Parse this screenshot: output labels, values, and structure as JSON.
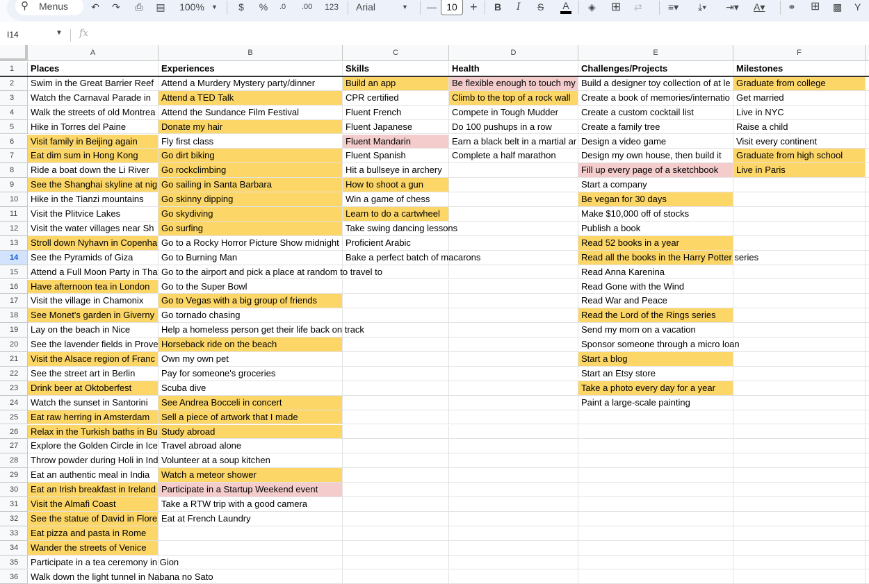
{
  "toolbar": {
    "menus_label": "Menus",
    "zoom": "100%",
    "currency": "$",
    "percent": "%",
    "decrease_decimals": ".0",
    "increase_decimals": ".00",
    "number_format": "123",
    "font": "Arial",
    "font_size": "10",
    "bold": "B",
    "italic": "I",
    "text_color": "A"
  },
  "formula_bar": {
    "cell_ref": "I14",
    "fx": "fx",
    "value": ""
  },
  "columns": [
    "A",
    "B",
    "C",
    "D",
    "E",
    "F"
  ],
  "selected_row": 14,
  "colors": {
    "yellow": "#fcd667",
    "pink": "#f4cccc",
    "selected_header": "#d3e3fd"
  },
  "rows": [
    {
      "n": "1",
      "bold": true,
      "cells": [
        {
          "t": "Places"
        },
        {
          "t": "Experiences"
        },
        {
          "t": "Skills"
        },
        {
          "t": "Health"
        },
        {
          "t": "Challenges/Projects"
        },
        {
          "t": "Milestones"
        }
      ]
    },
    {
      "n": "2",
      "cells": [
        {
          "t": "Swim in the Great Barrier Reef"
        },
        {
          "t": "Attend a Murdery Mystery party/dinner"
        },
        {
          "t": "Build an app",
          "f": "yellow"
        },
        {
          "t": "Be flexible enough to touch my",
          "f": "pink"
        },
        {
          "t": "Build a designer toy collection of at le"
        },
        {
          "t": "Graduate from college",
          "f": "yellow"
        }
      ]
    },
    {
      "n": "3",
      "cells": [
        {
          "t": "Watch the Carnaval Parade in"
        },
        {
          "t": "Attend a TED Talk",
          "f": "yellow"
        },
        {
          "t": "CPR certified"
        },
        {
          "t": "Climb to the top of a rock wall",
          "f": "yellow"
        },
        {
          "t": "Create a book of memories/internatio"
        },
        {
          "t": "Get married"
        }
      ]
    },
    {
      "n": "4",
      "cells": [
        {
          "t": "Walk the streets of old Montrea"
        },
        {
          "t": "Attend the Sundance Film Festival"
        },
        {
          "t": "Fluent French"
        },
        {
          "t": "Compete in Tough Mudder"
        },
        {
          "t": "Create a custom cocktail list"
        },
        {
          "t": "Live in NYC"
        }
      ]
    },
    {
      "n": "5",
      "cells": [
        {
          "t": "Hike in Torres del Paine"
        },
        {
          "t": "Donate my hair",
          "f": "yellow"
        },
        {
          "t": "Fluent Japanese"
        },
        {
          "t": "Do 100 pushups in a row"
        },
        {
          "t": "Create a family tree"
        },
        {
          "t": "Raise a child"
        }
      ]
    },
    {
      "n": "6",
      "cells": [
        {
          "t": "Visit family in Beijing again",
          "f": "yellow"
        },
        {
          "t": "Fly first class"
        },
        {
          "t": "Fluent Mandarin",
          "f": "pink"
        },
        {
          "t": "Earn a black belt in a martial ar"
        },
        {
          "t": "Design a video game"
        },
        {
          "t": "Visit every continent"
        }
      ]
    },
    {
      "n": "7",
      "cells": [
        {
          "t": "Eat dim sum in Hong Kong",
          "f": "yellow"
        },
        {
          "t": "Go dirt biking",
          "f": "yellow"
        },
        {
          "t": "Fluent Spanish"
        },
        {
          "t": "Complete a half marathon"
        },
        {
          "t": "Design my own house, then build it"
        },
        {
          "t": "Graduate from high school",
          "f": "yellow"
        }
      ]
    },
    {
      "n": "8",
      "cells": [
        {
          "t": "Ride a boat down the Li River"
        },
        {
          "t": "Go rockclimbing",
          "f": "yellow"
        },
        {
          "t": "Hit a bullseye in archery"
        },
        {
          "t": ""
        },
        {
          "t": "Fill up every page of a sketchbook",
          "f": "pink"
        },
        {
          "t": "Live in Paris",
          "f": "yellow"
        }
      ]
    },
    {
      "n": "9",
      "cells": [
        {
          "t": "See the Shanghai skyline at nig",
          "f": "yellow"
        },
        {
          "t": "Go sailing in Santa Barbara",
          "f": "yellow"
        },
        {
          "t": "How to shoot a gun",
          "f": "yellow"
        },
        {
          "t": ""
        },
        {
          "t": "Start a company"
        },
        {
          "t": ""
        }
      ]
    },
    {
      "n": "10",
      "cells": [
        {
          "t": "Hike in the Tianzi mountains"
        },
        {
          "t": "Go skinny dipping",
          "f": "yellow"
        },
        {
          "t": "Win a game of chess"
        },
        {
          "t": ""
        },
        {
          "t": "Be vegan for 30 days",
          "f": "yellow"
        },
        {
          "t": ""
        }
      ]
    },
    {
      "n": "11",
      "cells": [
        {
          "t": "Visit the Plitvice Lakes"
        },
        {
          "t": "Go skydiving",
          "f": "yellow"
        },
        {
          "t": "Learn to do a cartwheel",
          "f": "yellow"
        },
        {
          "t": ""
        },
        {
          "t": "Make $10,000 off of stocks"
        },
        {
          "t": ""
        }
      ]
    },
    {
      "n": "12",
      "cells": [
        {
          "t": "Visit the water villages near Sh"
        },
        {
          "t": "Go surfing",
          "f": "yellow"
        },
        {
          "t": "Take swing dancing lessons"
        },
        {
          "t": ""
        },
        {
          "t": "Publish a book"
        },
        {
          "t": ""
        }
      ]
    },
    {
      "n": "13",
      "cells": [
        {
          "t": "Stroll down Nyhavn in Copenha",
          "f": "yellow"
        },
        {
          "t": "Go to a Rocky Horror Picture Show midnight"
        },
        {
          "t": "Proficient Arabic"
        },
        {
          "t": ""
        },
        {
          "t": "Read 52 books in a year",
          "f": "yellow"
        },
        {
          "t": ""
        }
      ]
    },
    {
      "n": "14",
      "cells": [
        {
          "t": "See the Pyramids of Giza"
        },
        {
          "t": "Go to Burning Man"
        },
        {
          "t": "Bake a perfect batch of macarons"
        },
        {
          "t": ""
        },
        {
          "t": "Read all the books in the Harry Potter series",
          "f": "yellow"
        },
        {
          "t": ""
        }
      ]
    },
    {
      "n": "15",
      "cells": [
        {
          "t": "Attend a Full Moon Party in Tha"
        },
        {
          "t": "Go to the airport and pick a place at random to travel to"
        },
        {
          "t": ""
        },
        {
          "t": ""
        },
        {
          "t": "Read Anna Karenina"
        },
        {
          "t": ""
        }
      ]
    },
    {
      "n": "16",
      "cells": [
        {
          "t": "Have afternoon tea in London",
          "f": "yellow"
        },
        {
          "t": "Go to the Super Bowl"
        },
        {
          "t": ""
        },
        {
          "t": ""
        },
        {
          "t": "Read Gone with the Wind"
        },
        {
          "t": ""
        }
      ]
    },
    {
      "n": "17",
      "cells": [
        {
          "t": "Visit the village in Chamonix"
        },
        {
          "t": "Go to Vegas with a big group of friends",
          "f": "yellow"
        },
        {
          "t": ""
        },
        {
          "t": ""
        },
        {
          "t": "Read War and Peace"
        },
        {
          "t": ""
        }
      ]
    },
    {
      "n": "18",
      "cells": [
        {
          "t": "See Monet's garden in Giverny",
          "f": "yellow"
        },
        {
          "t": "Go tornado chasing"
        },
        {
          "t": ""
        },
        {
          "t": ""
        },
        {
          "t": "Read the Lord of the Rings series",
          "f": "yellow"
        },
        {
          "t": ""
        }
      ]
    },
    {
      "n": "19",
      "cells": [
        {
          "t": "Lay on the beach in Nice"
        },
        {
          "t": "Help a homeless person get their life back on track"
        },
        {
          "t": ""
        },
        {
          "t": ""
        },
        {
          "t": "Send my mom on a vacation"
        },
        {
          "t": ""
        }
      ]
    },
    {
      "n": "20",
      "cells": [
        {
          "t": "See the lavender fields in Prove"
        },
        {
          "t": "Horseback ride on the beach",
          "f": "yellow"
        },
        {
          "t": ""
        },
        {
          "t": ""
        },
        {
          "t": "Sponsor someone through a micro loan"
        },
        {
          "t": ""
        }
      ]
    },
    {
      "n": "21",
      "cells": [
        {
          "t": "Visit the Alsace region of Franc",
          "f": "yellow"
        },
        {
          "t": "Own my own pet"
        },
        {
          "t": ""
        },
        {
          "t": ""
        },
        {
          "t": "Start a blog",
          "f": "yellow"
        },
        {
          "t": ""
        }
      ]
    },
    {
      "n": "22",
      "cells": [
        {
          "t": "See the street art in Berlin"
        },
        {
          "t": "Pay for someone's groceries"
        },
        {
          "t": ""
        },
        {
          "t": ""
        },
        {
          "t": "Start an Etsy store"
        },
        {
          "t": ""
        }
      ]
    },
    {
      "n": "23",
      "cells": [
        {
          "t": "Drink beer at Oktoberfest",
          "f": "yellow"
        },
        {
          "t": "Scuba dive"
        },
        {
          "t": ""
        },
        {
          "t": ""
        },
        {
          "t": "Take a photo every day for a year",
          "f": "yellow"
        },
        {
          "t": ""
        }
      ]
    },
    {
      "n": "24",
      "cells": [
        {
          "t": "Watch the sunset in Santorini"
        },
        {
          "t": "See Andrea Bocceli in concert",
          "f": "yellow"
        },
        {
          "t": ""
        },
        {
          "t": ""
        },
        {
          "t": "Paint a large-scale painting"
        },
        {
          "t": ""
        }
      ]
    },
    {
      "n": "25",
      "cells": [
        {
          "t": "Eat raw herring in Amsterdam",
          "f": "yellow"
        },
        {
          "t": "Sell a piece of artwork that I made",
          "f": "yellow"
        },
        {
          "t": ""
        },
        {
          "t": ""
        },
        {
          "t": ""
        },
        {
          "t": ""
        }
      ]
    },
    {
      "n": "26",
      "cells": [
        {
          "t": "Relax in the Turkish baths in Bu",
          "f": "yellow"
        },
        {
          "t": "Study abroad",
          "f": "yellow"
        },
        {
          "t": ""
        },
        {
          "t": ""
        },
        {
          "t": ""
        },
        {
          "t": ""
        }
      ]
    },
    {
      "n": "27",
      "cells": [
        {
          "t": "Explore the Golden Circle in Ice"
        },
        {
          "t": "Travel abroad alone"
        },
        {
          "t": ""
        },
        {
          "t": ""
        },
        {
          "t": ""
        },
        {
          "t": ""
        }
      ]
    },
    {
      "n": "28",
      "cells": [
        {
          "t": "Throw powder during Holi in Ind"
        },
        {
          "t": "Volunteer at a soup kitchen"
        },
        {
          "t": ""
        },
        {
          "t": ""
        },
        {
          "t": ""
        },
        {
          "t": ""
        }
      ]
    },
    {
      "n": "29",
      "cells": [
        {
          "t": "Eat an authentic meal in India"
        },
        {
          "t": "Watch a meteor shower",
          "f": "yellow"
        },
        {
          "t": ""
        },
        {
          "t": ""
        },
        {
          "t": ""
        },
        {
          "t": ""
        }
      ]
    },
    {
      "n": "30",
      "cells": [
        {
          "t": "Eat an Irish breakfast in Ireland",
          "f": "yellow"
        },
        {
          "t": "Participate in a Startup Weekend event",
          "f": "pink"
        },
        {
          "t": ""
        },
        {
          "t": ""
        },
        {
          "t": ""
        },
        {
          "t": ""
        }
      ]
    },
    {
      "n": "31",
      "cells": [
        {
          "t": "Visit the Almafi Coast",
          "f": "yellow"
        },
        {
          "t": "Take a RTW trip with a good camera"
        },
        {
          "t": ""
        },
        {
          "t": ""
        },
        {
          "t": ""
        },
        {
          "t": ""
        }
      ]
    },
    {
      "n": "32",
      "cells": [
        {
          "t": "See the statue of David in Flore",
          "f": "yellow"
        },
        {
          "t": "Eat at French Laundry"
        },
        {
          "t": ""
        },
        {
          "t": ""
        },
        {
          "t": ""
        },
        {
          "t": ""
        }
      ]
    },
    {
      "n": "33",
      "cells": [
        {
          "t": "Eat pizza and pasta in Rome",
          "f": "yellow"
        },
        {
          "t": ""
        },
        {
          "t": ""
        },
        {
          "t": ""
        },
        {
          "t": ""
        },
        {
          "t": ""
        }
      ]
    },
    {
      "n": "34",
      "cells": [
        {
          "t": "Wander the streets of Venice",
          "f": "yellow"
        },
        {
          "t": ""
        },
        {
          "t": ""
        },
        {
          "t": ""
        },
        {
          "t": ""
        },
        {
          "t": ""
        }
      ]
    },
    {
      "n": "35",
      "cells": [
        {
          "t": "Participate in a tea ceremony in Gion"
        },
        {
          "t": ""
        },
        {
          "t": ""
        },
        {
          "t": ""
        },
        {
          "t": ""
        },
        {
          "t": ""
        }
      ]
    },
    {
      "n": "36",
      "cells": [
        {
          "t": "Walk down the light tunnel in Nabana no Sato"
        },
        {
          "t": ""
        },
        {
          "t": ""
        },
        {
          "t": ""
        },
        {
          "t": ""
        },
        {
          "t": ""
        }
      ]
    }
  ]
}
